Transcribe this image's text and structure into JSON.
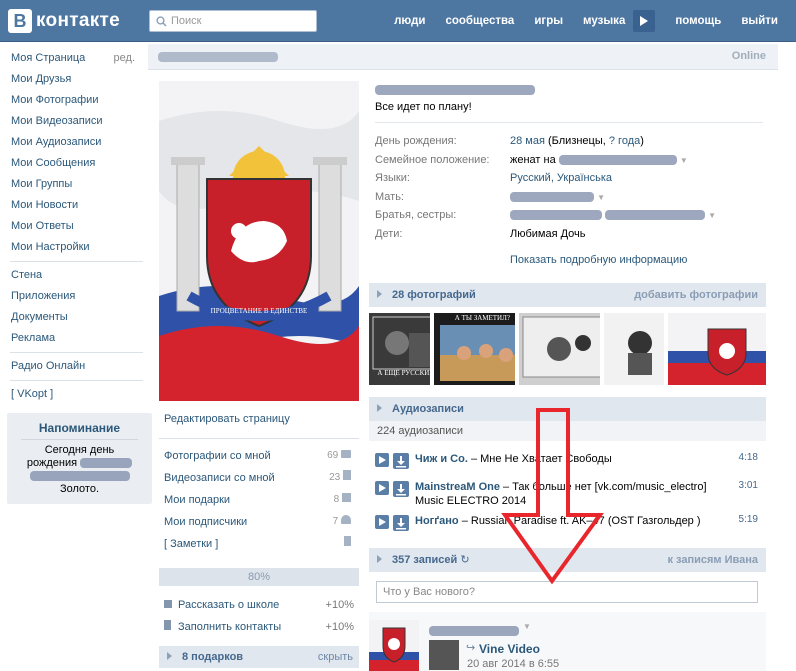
{
  "header": {
    "logo_letter": "В",
    "logo_text": "контакте",
    "search_placeholder": "Поиск",
    "nav": [
      "люди",
      "сообщества",
      "игры",
      "музыка",
      "помощь",
      "выйти"
    ]
  },
  "sidebar": {
    "edit_label": "ред.",
    "items": [
      "Моя Страница",
      "Мои Друзья",
      "Мои Фотографии",
      "Мои Видеозаписи",
      "Мои Аудиозаписи",
      "Мои Сообщения",
      "Мои Группы",
      "Мои Новости",
      "Мои Ответы",
      "Мои Настройки"
    ],
    "items2": [
      "Стена",
      "Приложения",
      "Документы",
      "Реклама"
    ],
    "items3": [
      "Радио Онлайн"
    ],
    "items4": [
      "[ VKopt ]"
    ],
    "reminder": {
      "title": "Напоминание",
      "line1": "Сегодня день",
      "line2": "рождения",
      "line4": "Золото."
    }
  },
  "profile": {
    "online": "Online",
    "status": "Все идет по плану!",
    "fields": [
      {
        "label": "День рождения:",
        "value": "28 мая",
        "extra": " (Близнецы, ",
        "link2": "? года",
        "end": ")"
      },
      {
        "label": "Семейное положение:",
        "value": "женат на"
      },
      {
        "label": "Языки:",
        "value": "Русский, Українська"
      },
      {
        "label": "Мать:",
        "value": ""
      },
      {
        "label": "Братья, сестры:",
        "value": ""
      },
      {
        "label": "Дети:",
        "value": "Любимая Дочь"
      }
    ],
    "more_info": "Показать подробную информацию"
  },
  "left_col": {
    "edit_page": "Редактировать страницу",
    "links": [
      {
        "label": "Фотографии со мной",
        "count": "69",
        "icon": "camera-icon"
      },
      {
        "label": "Видеозаписи со мной",
        "count": "23",
        "icon": "film-icon"
      },
      {
        "label": "Мои подарки",
        "count": "8",
        "icon": "gift-icon"
      },
      {
        "label": "Мои подписчики",
        "count": "7",
        "icon": "people-icon"
      },
      {
        "label": "[ Заметки ]",
        "count": "",
        "icon": "note-icon"
      }
    ],
    "progress_label": "80%",
    "progress_value": 0.8,
    "tasks": [
      {
        "label": "Рассказать о школе",
        "value": "+10%",
        "icon": "lock-icon"
      },
      {
        "label": "Заполнить контакты",
        "value": "+10%",
        "icon": "phone-icon"
      }
    ],
    "gifts_title": "8 подарков",
    "gifts_link": "скрыть"
  },
  "photos_block": {
    "title": "28 фотографий",
    "action": "добавить фотографии",
    "captions": [
      "А ЕЩЁ РУССКИЕ",
      "А ТЫ ЗАМЕТИЛ?"
    ]
  },
  "audio_block": {
    "title": "Аудиозаписи",
    "count": "224 аудиозаписи",
    "tracks": [
      {
        "artist": "Чиж и Со.",
        "title": " – Мне Не Хватает Свободы",
        "duration": "4:18"
      },
      {
        "artist": "MainstreaM One",
        "title": " – Так больше нет [vk.com/music_electro] Music ELECTRO 2014",
        "duration": "3:01"
      },
      {
        "artist": "Ногґано",
        "title": " – Russian Paradise ft. AK–47 (OST Газгольдер )",
        "duration": "5:19"
      }
    ]
  },
  "wall": {
    "title": "357 записей",
    "refresh_icon": "↻",
    "link": "к записям Ивана",
    "placeholder": "Что у Вас нового?",
    "post_app": "Vine Video",
    "post_date": "20 авг 2014 в 6:55"
  },
  "colors": {
    "header_bg": "#4d76a1",
    "link": "#2b587a",
    "block_head": "#e1e7ee",
    "arrow": "#e8262b"
  }
}
